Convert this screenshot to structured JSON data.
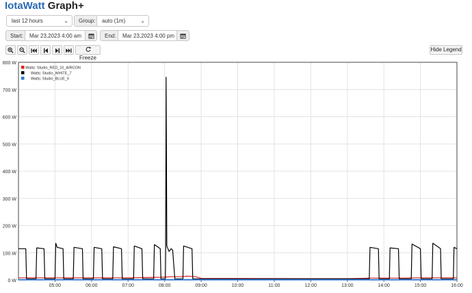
{
  "app": {
    "brand": "IotaWatt",
    "title_suffix": "Graph+"
  },
  "controls": {
    "period_value": "last 12 hours",
    "group_label": "Group:",
    "group_value": "auto (1m)",
    "start_label": "Start:",
    "start_value": "Mar 23,2023 4:00 am",
    "end_label": "End:",
    "end_value": "Mar 23,2023 4:00 pm"
  },
  "toolbar": {
    "freeze_label": "Freeze",
    "hide_legend_label": "Hide Legend",
    "icons": [
      "zoom-in-icon",
      "zoom-out-icon",
      "skip-back-icon",
      "step-back-icon",
      "step-forward-icon",
      "skip-forward-icon",
      "refresh-icon"
    ]
  },
  "chart_data": {
    "type": "line",
    "x_ticks": [
      "05:00",
      "06:00",
      "07:00",
      "08:00",
      "09:00",
      "10:00",
      "11:00",
      "12:00",
      "13:00",
      "14:00",
      "15:00",
      "16:00"
    ],
    "y_ticks": [
      "0 W",
      "100 W",
      "200 W",
      "300 W",
      "400 W",
      "500 W",
      "600 W",
      "700 W",
      "800 W"
    ],
    "xlim": [
      4.0,
      16.0
    ],
    "ylim": [
      0,
      800
    ],
    "grid": true,
    "legend_position": "top-left",
    "series": [
      {
        "name": "Watts: Studio_RED_10_AIRCON",
        "color": "#e02020",
        "points": [
          [
            4.0,
            8
          ],
          [
            5.0,
            8
          ],
          [
            6.0,
            8
          ],
          [
            7.0,
            8
          ],
          [
            7.5,
            9
          ],
          [
            7.9,
            10
          ],
          [
            8.2,
            12
          ],
          [
            8.5,
            12
          ],
          [
            8.6,
            14
          ],
          [
            8.85,
            12
          ],
          [
            9.0,
            6
          ],
          [
            12.0,
            5
          ],
          [
            13.0,
            5
          ],
          [
            13.4,
            6
          ],
          [
            13.6,
            7
          ],
          [
            14.5,
            7
          ],
          [
            15.0,
            8
          ],
          [
            16.0,
            8
          ]
        ]
      },
      {
        "name": "Watts: Studio_WHITE_7",
        "color": "#000000",
        "points": [
          [
            4.0,
            115
          ],
          [
            4.2,
            115
          ],
          [
            4.22,
            4
          ],
          [
            4.48,
            4
          ],
          [
            4.5,
            118
          ],
          [
            4.7,
            115
          ],
          [
            4.72,
            4
          ],
          [
            5.0,
            4
          ],
          [
            5.02,
            135
          ],
          [
            5.06,
            120
          ],
          [
            5.22,
            115
          ],
          [
            5.24,
            4
          ],
          [
            5.5,
            4
          ],
          [
            5.52,
            120
          ],
          [
            5.75,
            115
          ],
          [
            5.77,
            4
          ],
          [
            6.05,
            4
          ],
          [
            6.07,
            120
          ],
          [
            6.28,
            115
          ],
          [
            6.3,
            4
          ],
          [
            6.58,
            4
          ],
          [
            6.6,
            122
          ],
          [
            6.82,
            115
          ],
          [
            6.84,
            4
          ],
          [
            7.15,
            4
          ],
          [
            7.17,
            125
          ],
          [
            7.38,
            115
          ],
          [
            7.4,
            4
          ],
          [
            7.7,
            4
          ],
          [
            7.72,
            130
          ],
          [
            7.88,
            115
          ],
          [
            7.9,
            4
          ],
          [
            8.02,
            4
          ],
          [
            8.03,
            120
          ],
          [
            8.04,
            745
          ],
          [
            8.06,
            125
          ],
          [
            8.12,
            105
          ],
          [
            8.18,
            115
          ],
          [
            8.22,
            110
          ],
          [
            8.28,
            4
          ],
          [
            8.5,
            4
          ],
          [
            8.52,
            125
          ],
          [
            8.75,
            115
          ],
          [
            8.77,
            4
          ],
          [
            9.0,
            4
          ],
          [
            12.0,
            4
          ],
          [
            13.0,
            4
          ],
          [
            13.5,
            4
          ],
          [
            13.6,
            4
          ],
          [
            13.62,
            120
          ],
          [
            13.85,
            115
          ],
          [
            13.87,
            4
          ],
          [
            14.15,
            4
          ],
          [
            14.17,
            118
          ],
          [
            14.4,
            115
          ],
          [
            14.42,
            4
          ],
          [
            14.75,
            4
          ],
          [
            14.77,
            132
          ],
          [
            15.0,
            115
          ],
          [
            15.02,
            4
          ],
          [
            15.32,
            4
          ],
          [
            15.34,
            135
          ],
          [
            15.55,
            115
          ],
          [
            15.57,
            4
          ],
          [
            15.9,
            4
          ],
          [
            15.92,
            120
          ],
          [
            16.0,
            115
          ]
        ]
      },
      {
        "name": "Watts: Studio_BLUE_6",
        "color": "#2f7bd6",
        "points": [
          [
            4.0,
            1
          ],
          [
            16.0,
            1
          ]
        ]
      }
    ]
  }
}
